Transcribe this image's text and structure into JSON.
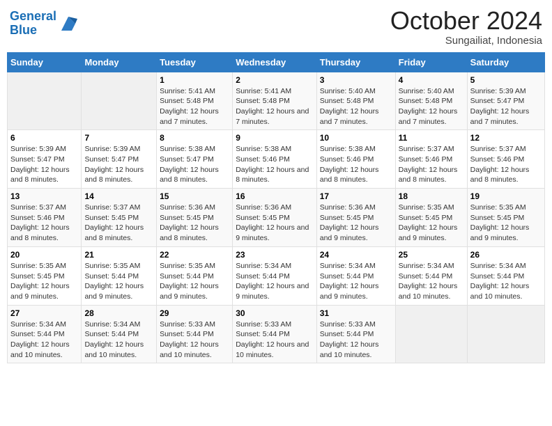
{
  "header": {
    "logo_line1": "General",
    "logo_line2": "Blue",
    "month": "October 2024",
    "location": "Sungailiat, Indonesia"
  },
  "columns": [
    "Sunday",
    "Monday",
    "Tuesday",
    "Wednesday",
    "Thursday",
    "Friday",
    "Saturday"
  ],
  "weeks": [
    [
      {
        "day": "",
        "empty": true
      },
      {
        "day": "",
        "empty": true
      },
      {
        "day": "1",
        "sunrise": "5:41 AM",
        "sunset": "5:48 PM",
        "daylight": "Daylight: 12 hours and 7 minutes."
      },
      {
        "day": "2",
        "sunrise": "5:41 AM",
        "sunset": "5:48 PM",
        "daylight": "Daylight: 12 hours and 7 minutes."
      },
      {
        "day": "3",
        "sunrise": "5:40 AM",
        "sunset": "5:48 PM",
        "daylight": "Daylight: 12 hours and 7 minutes."
      },
      {
        "day": "4",
        "sunrise": "5:40 AM",
        "sunset": "5:48 PM",
        "daylight": "Daylight: 12 hours and 7 minutes."
      },
      {
        "day": "5",
        "sunrise": "5:39 AM",
        "sunset": "5:47 PM",
        "daylight": "Daylight: 12 hours and 7 minutes."
      }
    ],
    [
      {
        "day": "6",
        "sunrise": "5:39 AM",
        "sunset": "5:47 PM",
        "daylight": "Daylight: 12 hours and 8 minutes."
      },
      {
        "day": "7",
        "sunrise": "5:39 AM",
        "sunset": "5:47 PM",
        "daylight": "Daylight: 12 hours and 8 minutes."
      },
      {
        "day": "8",
        "sunrise": "5:38 AM",
        "sunset": "5:47 PM",
        "daylight": "Daylight: 12 hours and 8 minutes."
      },
      {
        "day": "9",
        "sunrise": "5:38 AM",
        "sunset": "5:46 PM",
        "daylight": "Daylight: 12 hours and 8 minutes."
      },
      {
        "day": "10",
        "sunrise": "5:38 AM",
        "sunset": "5:46 PM",
        "daylight": "Daylight: 12 hours and 8 minutes."
      },
      {
        "day": "11",
        "sunrise": "5:37 AM",
        "sunset": "5:46 PM",
        "daylight": "Daylight: 12 hours and 8 minutes."
      },
      {
        "day": "12",
        "sunrise": "5:37 AM",
        "sunset": "5:46 PM",
        "daylight": "Daylight: 12 hours and 8 minutes."
      }
    ],
    [
      {
        "day": "13",
        "sunrise": "5:37 AM",
        "sunset": "5:46 PM",
        "daylight": "Daylight: 12 hours and 8 minutes."
      },
      {
        "day": "14",
        "sunrise": "5:37 AM",
        "sunset": "5:45 PM",
        "daylight": "Daylight: 12 hours and 8 minutes."
      },
      {
        "day": "15",
        "sunrise": "5:36 AM",
        "sunset": "5:45 PM",
        "daylight": "Daylight: 12 hours and 8 minutes."
      },
      {
        "day": "16",
        "sunrise": "5:36 AM",
        "sunset": "5:45 PM",
        "daylight": "Daylight: 12 hours and 9 minutes."
      },
      {
        "day": "17",
        "sunrise": "5:36 AM",
        "sunset": "5:45 PM",
        "daylight": "Daylight: 12 hours and 9 minutes."
      },
      {
        "day": "18",
        "sunrise": "5:35 AM",
        "sunset": "5:45 PM",
        "daylight": "Daylight: 12 hours and 9 minutes."
      },
      {
        "day": "19",
        "sunrise": "5:35 AM",
        "sunset": "5:45 PM",
        "daylight": "Daylight: 12 hours and 9 minutes."
      }
    ],
    [
      {
        "day": "20",
        "sunrise": "5:35 AM",
        "sunset": "5:45 PM",
        "daylight": "Daylight: 12 hours and 9 minutes."
      },
      {
        "day": "21",
        "sunrise": "5:35 AM",
        "sunset": "5:44 PM",
        "daylight": "Daylight: 12 hours and 9 minutes."
      },
      {
        "day": "22",
        "sunrise": "5:35 AM",
        "sunset": "5:44 PM",
        "daylight": "Daylight: 12 hours and 9 minutes."
      },
      {
        "day": "23",
        "sunrise": "5:34 AM",
        "sunset": "5:44 PM",
        "daylight": "Daylight: 12 hours and 9 minutes."
      },
      {
        "day": "24",
        "sunrise": "5:34 AM",
        "sunset": "5:44 PM",
        "daylight": "Daylight: 12 hours and 9 minutes."
      },
      {
        "day": "25",
        "sunrise": "5:34 AM",
        "sunset": "5:44 PM",
        "daylight": "Daylight: 12 hours and 10 minutes."
      },
      {
        "day": "26",
        "sunrise": "5:34 AM",
        "sunset": "5:44 PM",
        "daylight": "Daylight: 12 hours and 10 minutes."
      }
    ],
    [
      {
        "day": "27",
        "sunrise": "5:34 AM",
        "sunset": "5:44 PM",
        "daylight": "Daylight: 12 hours and 10 minutes."
      },
      {
        "day": "28",
        "sunrise": "5:34 AM",
        "sunset": "5:44 PM",
        "daylight": "Daylight: 12 hours and 10 minutes."
      },
      {
        "day": "29",
        "sunrise": "5:33 AM",
        "sunset": "5:44 PM",
        "daylight": "Daylight: 12 hours and 10 minutes."
      },
      {
        "day": "30",
        "sunrise": "5:33 AM",
        "sunset": "5:44 PM",
        "daylight": "Daylight: 12 hours and 10 minutes."
      },
      {
        "day": "31",
        "sunrise": "5:33 AM",
        "sunset": "5:44 PM",
        "daylight": "Daylight: 12 hours and 10 minutes."
      },
      {
        "day": "",
        "empty": true
      },
      {
        "day": "",
        "empty": true
      }
    ]
  ]
}
